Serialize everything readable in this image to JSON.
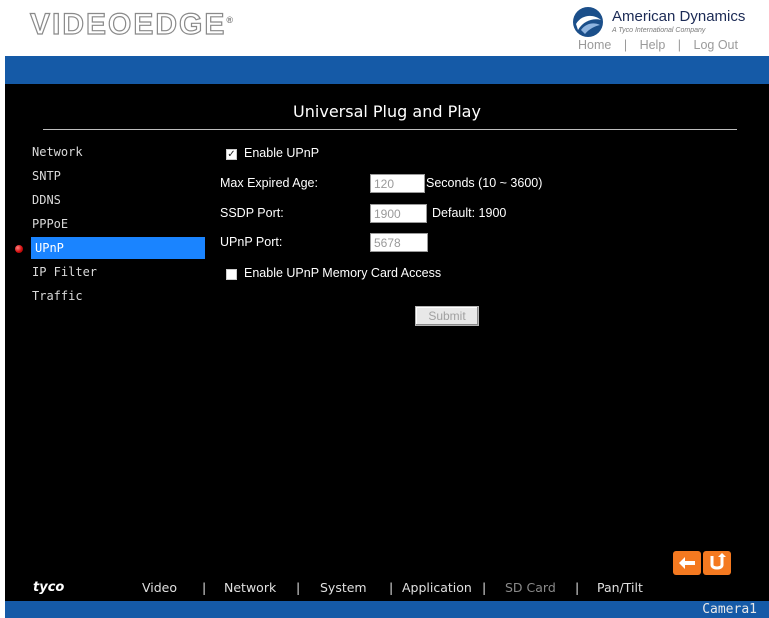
{
  "header": {
    "logo_text": "VIDEOEDGE",
    "logo_mark": "®",
    "brand_name": "American Dynamics",
    "brand_sub": "A Tyco International Company",
    "links": {
      "home": "Home",
      "help": "Help",
      "logout": "Log Out",
      "sep": "|"
    }
  },
  "page": {
    "title": "Universal Plug and Play"
  },
  "sidebar": {
    "items": [
      {
        "label": "Network"
      },
      {
        "label": "SNTP"
      },
      {
        "label": "DDNS"
      },
      {
        "label": "PPPoE"
      },
      {
        "label": "UPnP",
        "active": true
      },
      {
        "label": "IP Filter"
      },
      {
        "label": "Traffic"
      }
    ]
  },
  "form": {
    "enable_upnp": {
      "label": "Enable UPnP",
      "checked": true
    },
    "max_expired_age": {
      "label": "Max Expired Age:",
      "value": "120",
      "hint": "Seconds (10 ~ 3600)"
    },
    "ssdp_port": {
      "label": "SSDP Port:",
      "value": "1900",
      "hint": "Default: 1900"
    },
    "upnp_port": {
      "label": "UPnP Port:",
      "value": "5678"
    },
    "enable_memory_card": {
      "label": "Enable UPnP Memory Card Access",
      "checked": false
    },
    "submit_label": "Submit"
  },
  "nav_buttons": {
    "back": "back-arrow-icon",
    "refresh": "return-icon",
    "color": "#f47920"
  },
  "footer": {
    "logo": "tyco",
    "nav": [
      "Video",
      "Network",
      "System",
      "Application",
      "SD Card",
      "Pan/Tilt"
    ],
    "sep": "|",
    "camera": "Camera1"
  },
  "colors": {
    "accent_blue": "#155aa7",
    "active_item": "#1a84ff",
    "background": "#000000"
  }
}
